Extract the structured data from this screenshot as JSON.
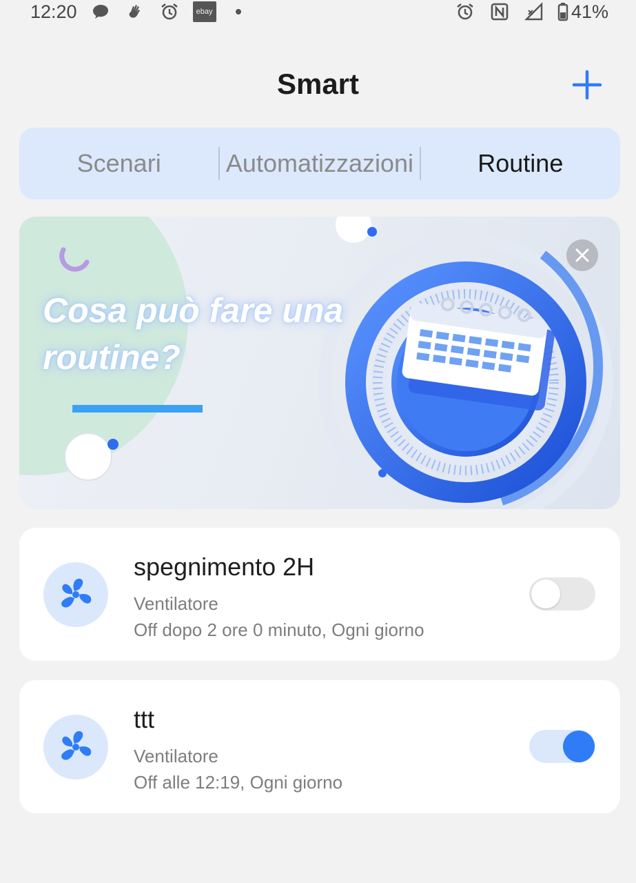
{
  "status_bar": {
    "time": "12:20",
    "left_icons": [
      "chat-bubble-icon",
      "hand-wave-icon",
      "alarm-icon",
      "ebay-icon",
      "dot-icon"
    ],
    "ebay_label": "ebay",
    "right_icons": [
      "alarm-icon",
      "nfc-icon",
      "signal-icon",
      "battery-icon"
    ],
    "battery": "41%"
  },
  "header": {
    "title": "Smart",
    "add_icon": "plus-icon"
  },
  "tabs": [
    {
      "label": "Scenari",
      "active": false
    },
    {
      "label": "Automatizzazioni",
      "active": false
    },
    {
      "label": "Routine",
      "active": true
    }
  ],
  "banner": {
    "headline": "Cosa può fare una routine?",
    "close_icon": "close-icon"
  },
  "routines": [
    {
      "name": "spegnimento 2H",
      "device": "Ventilatore",
      "detail": "Off dopo 2 ore 0 minuto, Ogni giorno",
      "enabled": false,
      "icon": "fan-icon"
    },
    {
      "name": "ttt",
      "device": "Ventilatore",
      "detail": "Off alle 12:19, Ogni giorno",
      "enabled": true,
      "icon": "fan-icon"
    }
  ],
  "colors": {
    "accent": "#2f7cf6",
    "tab_background": "#dce8fc",
    "page_background": "#f2f2f2"
  }
}
